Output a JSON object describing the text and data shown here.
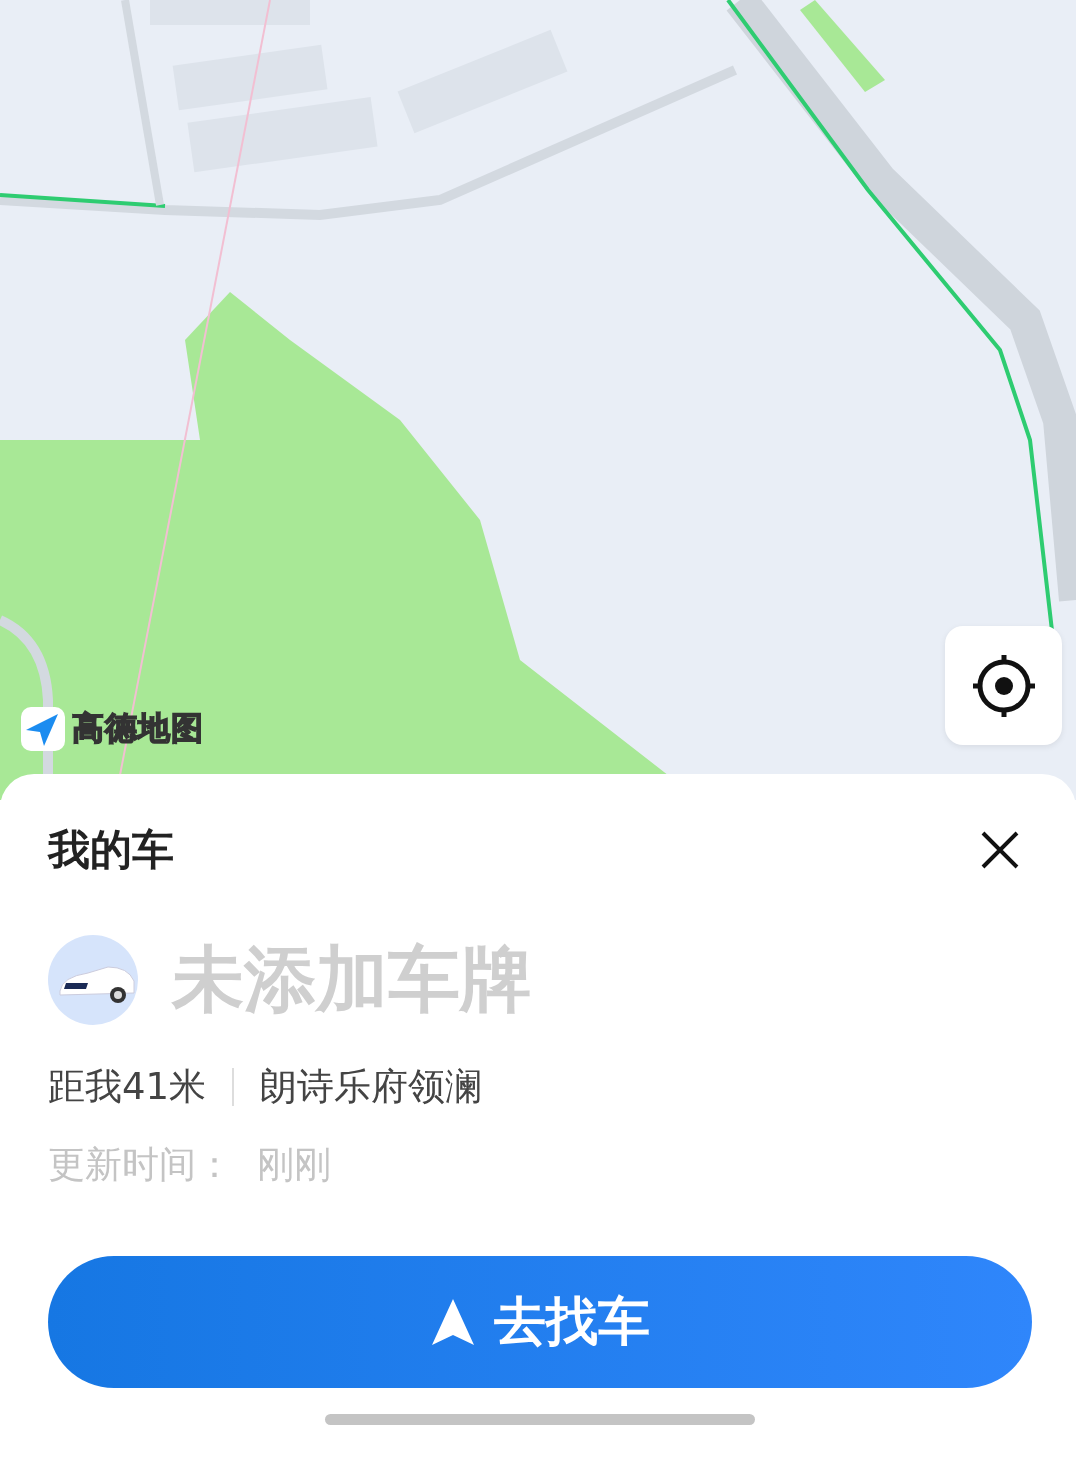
{
  "map": {
    "attribution": "高德地图"
  },
  "sheet": {
    "title": "我的车",
    "plate": "未添加车牌",
    "distance": "距我41米",
    "location": "朗诗乐府领澜",
    "updated": "更新时间：  刚刚",
    "action": "去找车"
  }
}
